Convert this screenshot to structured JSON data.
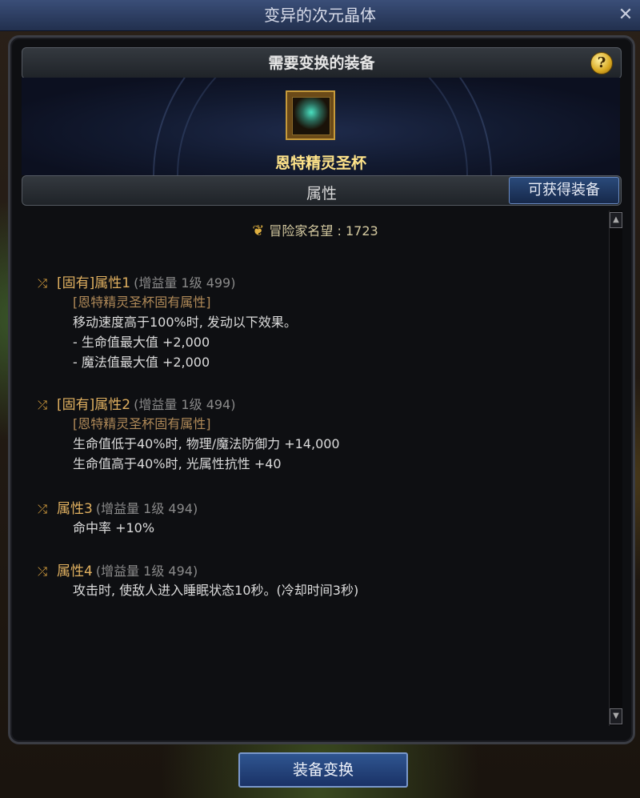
{
  "window_title": "变异的次元晶体",
  "header_title": "需要变换的装备",
  "help_label": "?",
  "item": {
    "name": "恩特精灵圣杯",
    "icon": "grail-icon"
  },
  "properties_header": "属性",
  "obtain_button": "可获得装备",
  "reputation": {
    "label": "冒险家名望",
    "value": "1723"
  },
  "attributes": [
    {
      "name": "[固有]属性1",
      "info": "(增益量 1级 499)",
      "lines": [
        {
          "kind": "tag",
          "text": "[恩特精灵圣杯固有属性]"
        },
        {
          "kind": "txt",
          "text": "移动速度高于100%时, 发动以下效果。"
        },
        {
          "kind": "txt",
          "text": "- 生命值最大值 +2,000"
        },
        {
          "kind": "txt",
          "text": "- 魔法值最大值 +2,000"
        }
      ]
    },
    {
      "name": "[固有]属性2",
      "info": "(增益量 1级 494)",
      "lines": [
        {
          "kind": "tag",
          "text": "[恩特精灵圣杯固有属性]"
        },
        {
          "kind": "txt",
          "text": "生命值低于40%时, 物理/魔法防御力 +14,000"
        },
        {
          "kind": "txt",
          "text": "生命值高于40%时, 光属性抗性 +40"
        }
      ]
    },
    {
      "name": "属性3",
      "info": "(增益量 1级 494)",
      "lines": [
        {
          "kind": "txt",
          "text": "命中率 +10%"
        }
      ]
    },
    {
      "name": "属性4",
      "info": "(增益量 1级 494)",
      "lines": [
        {
          "kind": "txt",
          "text": "攻击时, 使敌人进入睡眠状态10秒。(冷却时间3秒)"
        }
      ]
    }
  ],
  "confirm_button": "装备变换",
  "colors": {
    "accent_gold": "#e0b060",
    "button_blue": "#2f5590"
  }
}
